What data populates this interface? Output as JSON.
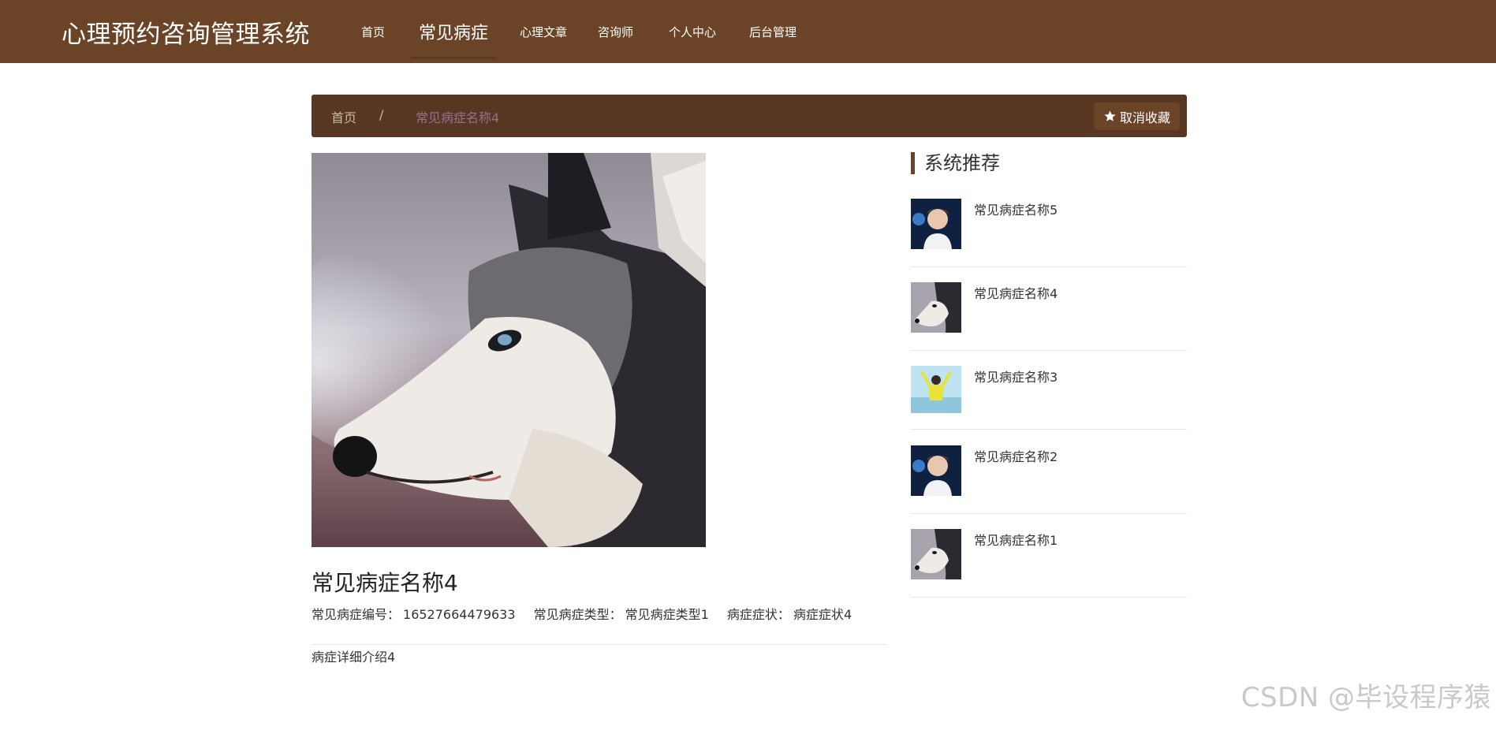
{
  "header": {
    "brand": "心理预约咨询管理系统",
    "nav": [
      "首页",
      "常见病症",
      "心理文章",
      "咨询师",
      "个人中心",
      "后台管理"
    ],
    "active_index": 1
  },
  "breadcrumb": {
    "home": "首页",
    "separator": "/",
    "current": "常见病症名称4",
    "fav_button": "取消收藏"
  },
  "detail": {
    "title": "常见病症名称4",
    "meta": [
      {
        "label": "常见病症编号：",
        "value": "16527664479633"
      },
      {
        "label": "常见病症类型：",
        "value": "常见病症类型1"
      },
      {
        "label": "病症症状：",
        "value": "病症症状4"
      }
    ],
    "description": "病症详细介绍4",
    "image": "husky-dog-photo"
  },
  "sidebar": {
    "title": "系统推荐",
    "items": [
      {
        "name": "常见病症名称5",
        "thumb": "young-man-photo"
      },
      {
        "name": "常见病症名称4",
        "thumb": "husky-dog-photo"
      },
      {
        "name": "常见病症名称3",
        "thumb": "girl-yellow-photo"
      },
      {
        "name": "常见病症名称2",
        "thumb": "young-man-photo"
      },
      {
        "name": "常见病症名称1",
        "thumb": "husky-dog-photo"
      }
    ]
  },
  "watermark": "CSDN @毕设程序猿",
  "colors": {
    "header_bg": "#6b4428",
    "crumb_bg": "#573721",
    "accent": "#6b4428"
  }
}
